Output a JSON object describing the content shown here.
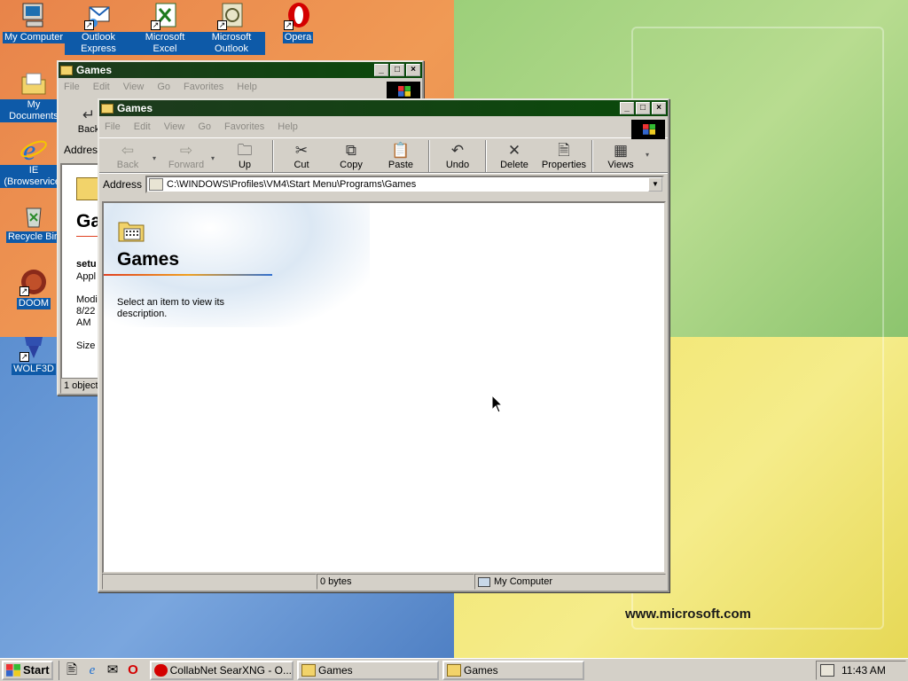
{
  "desktop": {
    "icons": [
      {
        "label": "My Computer",
        "icon": "computer-icon"
      },
      {
        "label": "Outlook Express",
        "icon": "outlook-express-icon"
      },
      {
        "label": "Microsoft Excel",
        "icon": "excel-icon"
      },
      {
        "label": "Microsoft Outlook",
        "icon": "outlook-icon"
      },
      {
        "label": "Opera",
        "icon": "opera-icon"
      },
      {
        "label": "My Documents",
        "icon": "folder-icon"
      },
      {
        "label": "IE (Browservice)",
        "icon": "internet-explorer-icon"
      },
      {
        "label": "Recycle Bin",
        "icon": "recycle-bin-icon"
      },
      {
        "label": "DOOM",
        "icon": "doom-icon"
      },
      {
        "label": "WOLF3D",
        "icon": "wolf3d-icon"
      }
    ],
    "wallpaper_url": "www.microsoft.com"
  },
  "back_window": {
    "title": "Games",
    "menu": [
      "File",
      "Edit",
      "View",
      "Go",
      "Favorites",
      "Help"
    ],
    "back_label": "Back",
    "address_label": "Addres",
    "heading": "Ga",
    "detail_name": "setu",
    "detail_type": "Appl",
    "detail_modified_label": "Modi",
    "detail_modified_date": "8/22",
    "detail_modified_time": "AM",
    "detail_size": "Size",
    "status": "1 object"
  },
  "front_window": {
    "title": "Games",
    "menu": [
      "File",
      "Edit",
      "View",
      "Go",
      "Favorites",
      "Help"
    ],
    "toolbar": {
      "back": "Back",
      "forward": "Forward",
      "up": "Up",
      "cut": "Cut",
      "copy": "Copy",
      "paste": "Paste",
      "undo": "Undo",
      "delete": "Delete",
      "properties": "Properties",
      "views": "Views"
    },
    "address_label": "Address",
    "address_value": "C:\\WINDOWS\\Profiles\\VM4\\Start Menu\\Programs\\Games",
    "folder_heading": "Games",
    "description": "Select an item to view its description.",
    "status": {
      "size": "0 bytes",
      "location": "My Computer"
    }
  },
  "taskbar": {
    "start_label": "Start",
    "tasks": [
      "CollabNet SearXNG - O...",
      "Games",
      "Games"
    ],
    "clock": "11:43 AM"
  },
  "colors": {
    "active_title": "#0a4a0a",
    "desktop_label_bg": "#0e5aa8"
  }
}
